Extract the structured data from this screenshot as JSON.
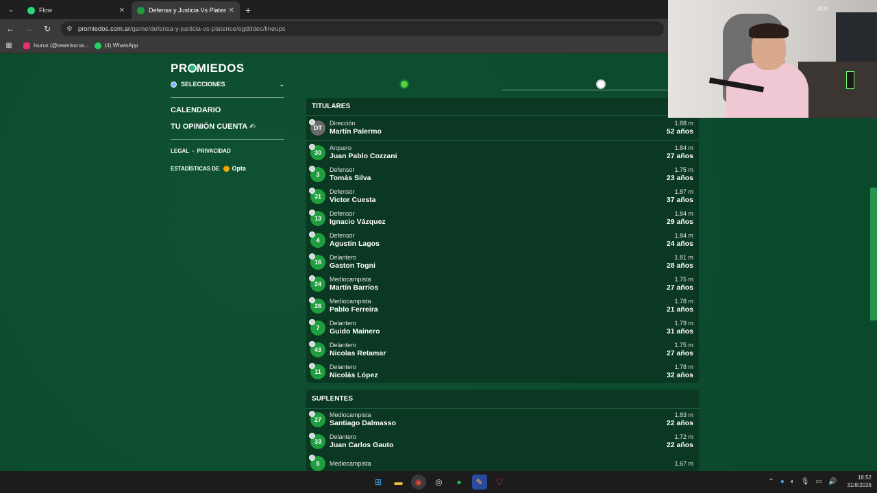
{
  "browser": {
    "tabs": [
      {
        "title": "Flow",
        "active": false,
        "color": "#2bd67b"
      },
      {
        "title": "Defensa y Justicia Vs Platense -",
        "active": true,
        "color": "#1f9e3d"
      }
    ],
    "url_host": "promiedos.com.ar",
    "url_path": "/game/defensa-y-justicia-vs-platense/egdddec/lineups",
    "bookmarks": [
      {
        "label": "Isurus (@teamisurus...",
        "color": "#e1306c"
      },
      {
        "label": "(4) WhatsApp",
        "color": "#25d366"
      }
    ]
  },
  "sidebar": {
    "logo": "PR⚽MIEDOS",
    "logo_left": "PR",
    "logo_right": "MIEDOS",
    "selecciones": "SELECCIONES",
    "menu": [
      "CALENDARIO",
      "TU OPINIÓN CUENTA ✍"
    ],
    "legal": "LEGAL",
    "privacidad": "PRIVACIDAD",
    "separator": "-",
    "stats_label": "ESTADÍSTICAS DE",
    "opta": "Opta"
  },
  "lineup": {
    "titulares_header": "TITULARES",
    "coach": {
      "number": "DT",
      "position": "Dirección",
      "name": "Martín Palermo",
      "height": "1.88 m",
      "age": "52 años"
    },
    "starters": [
      {
        "number": "30",
        "position": "Arquero",
        "name": "Juan Pablo Cozzani",
        "height": "1.84 m",
        "age": "27 años"
      },
      {
        "number": "3",
        "position": "Defensor",
        "name": "Tomás Silva",
        "height": "1.75 m",
        "age": "23 años"
      },
      {
        "number": "31",
        "position": "Defensor",
        "name": "Victor Cuesta",
        "height": "1.87 m",
        "age": "37 años"
      },
      {
        "number": "13",
        "position": "Defensor",
        "name": "Ignacio Vázquez",
        "height": "1.84 m",
        "age": "29 años"
      },
      {
        "number": "4",
        "position": "Defensor",
        "name": "Agustin Lagos",
        "height": "1.84 m",
        "age": "24 años"
      },
      {
        "number": "16",
        "position": "Delantero",
        "name": "Gaston Togni",
        "height": "1.81 m",
        "age": "28 años"
      },
      {
        "number": "24",
        "position": "Mediocampista",
        "name": "Martín Barrios",
        "height": "1.75 m",
        "age": "27 años"
      },
      {
        "number": "26",
        "position": "Mediocampista",
        "name": "Pablo Ferreira",
        "height": "1.78 m",
        "age": "21 años"
      },
      {
        "number": "7",
        "position": "Delantero",
        "name": "Guido Mainero",
        "height": "1.79 m",
        "age": "31 años"
      },
      {
        "number": "43",
        "position": "Delantero",
        "name": "Nicolas Retamar",
        "height": "1.75 m",
        "age": "27 años"
      },
      {
        "number": "11",
        "position": "Delantero",
        "name": "Nicolás López",
        "height": "1.78 m",
        "age": "32 años"
      }
    ],
    "suplentes_header": "SUPLENTES",
    "substitutes": [
      {
        "number": "27",
        "position": "Mediocampista",
        "name": "Santiago Dalmasso",
        "height": "1.83 m",
        "age": "22 años"
      },
      {
        "number": "33",
        "position": "Delantero",
        "name": "Juan Carlos Gauto",
        "height": "1.72 m",
        "age": "22 años"
      },
      {
        "number": "5",
        "position": "Mediocampista",
        "name": "",
        "height": "1.67 m",
        "age": ""
      }
    ]
  },
  "webcam": {
    "badge": "4IX"
  },
  "taskbar": {
    "time": "18:52",
    "date": "31/8/2026"
  }
}
